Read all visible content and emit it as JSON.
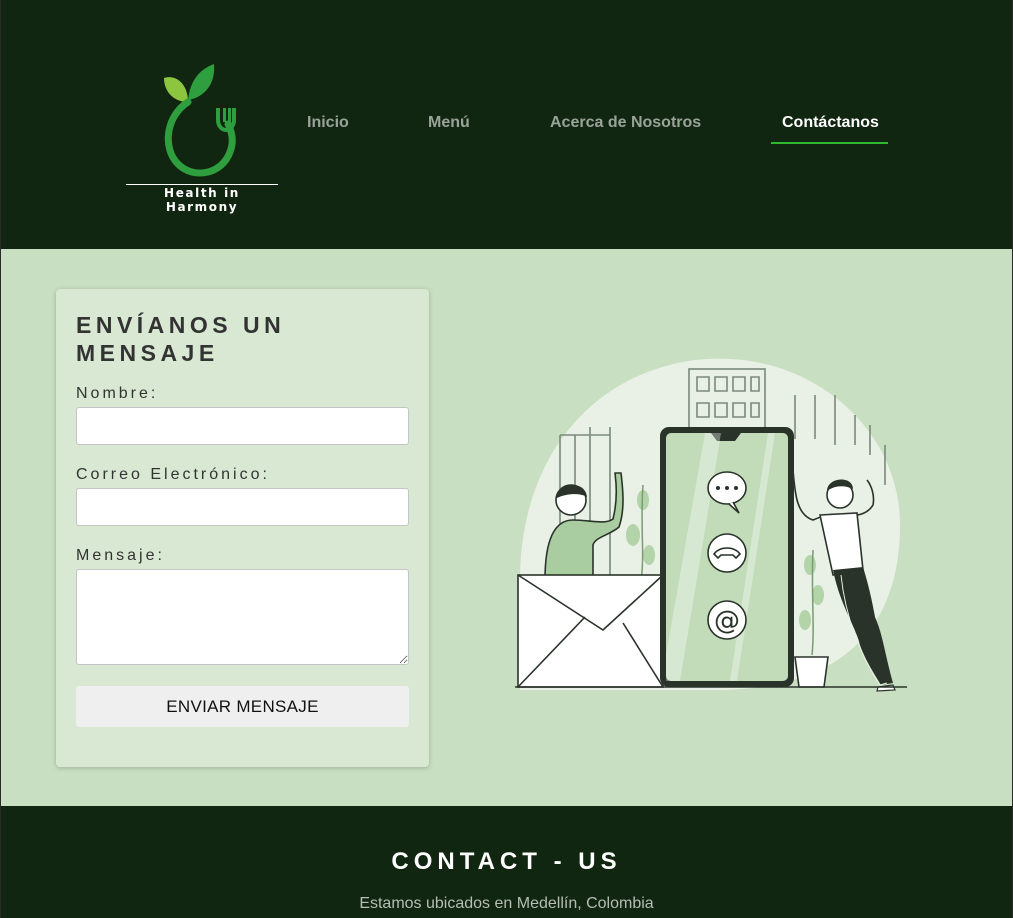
{
  "brand": {
    "name": "Health in Harmony",
    "accent": "#2eb82e",
    "dark_bg": "#112611",
    "page_bg": "#c9dfc1"
  },
  "nav": {
    "items": [
      {
        "label": "Inicio",
        "active": false
      },
      {
        "label": "Menú",
        "active": false
      },
      {
        "label": "Acerca de Nosotros",
        "active": false
      },
      {
        "label": "Contáctanos",
        "active": true
      }
    ]
  },
  "form": {
    "title": "ENVÍANOS UN MENSAJE",
    "name_label": "Nombre:",
    "name_value": "",
    "email_label": "Correo Electrónico:",
    "email_value": "",
    "message_label": "Mensaje:",
    "message_value": "",
    "submit_label": "ENVIAR MENSAJE"
  },
  "illustration": {
    "icons": [
      "chat-bubble-icon",
      "phone-icon",
      "at-sign-icon",
      "envelope-icon"
    ]
  },
  "footer": {
    "title": "CONTACT - US",
    "location": "Estamos ubicados en Medellín, Colombia"
  }
}
